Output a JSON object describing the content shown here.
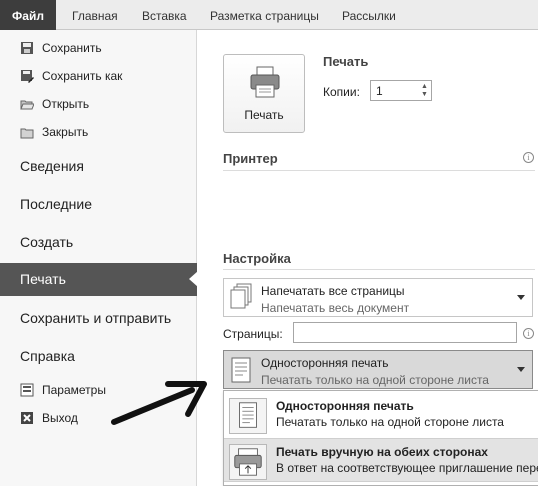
{
  "ribbon": {
    "tabs": [
      {
        "label": "Файл"
      },
      {
        "label": "Главная"
      },
      {
        "label": "Вставка"
      },
      {
        "label": "Разметка страницы"
      },
      {
        "label": "Рассылки"
      }
    ]
  },
  "nav": {
    "small_top": [
      {
        "label": "Сохранить",
        "icon": "save-icon"
      },
      {
        "label": "Сохранить как",
        "icon": "save-as-icon"
      },
      {
        "label": "Открыть",
        "icon": "open-folder-icon"
      },
      {
        "label": "Закрыть",
        "icon": "close-folder-icon"
      }
    ],
    "big": [
      {
        "label": "Сведения"
      },
      {
        "label": "Последние"
      },
      {
        "label": "Создать"
      },
      {
        "label": "Печать",
        "active": true
      },
      {
        "label": "Сохранить и отправить"
      },
      {
        "label": "Справка"
      }
    ],
    "small_bottom": [
      {
        "label": "Параметры",
        "icon": "options-icon"
      },
      {
        "label": "Выход",
        "icon": "exit-icon"
      }
    ]
  },
  "print": {
    "button_label": "Печать",
    "section_title": "Печать",
    "copies_label": "Копии:",
    "copies_value": "1"
  },
  "printer": {
    "title": "Принтер"
  },
  "settings": {
    "title": "Настройка",
    "pages_dropdown": {
      "title": "Напечатать все страницы",
      "subtitle": "Напечатать весь документ"
    },
    "pages_label": "Страницы:",
    "pages_value": "",
    "sides_dropdown": {
      "title": "Односторонняя печать",
      "subtitle": "Печатать только на одной стороне листа"
    },
    "menu": [
      {
        "title": "Односторонняя печать",
        "subtitle": "Печатать только на одной стороне листа"
      },
      {
        "title": "Печать вручную на обеих сторонах",
        "subtitle": "В ответ на соответствующее приглашение перез"
      }
    ]
  },
  "colors": {
    "file_tab": "#3d3d3d",
    "active_nav": "#555555",
    "ribbon_bg": "#ececec"
  }
}
